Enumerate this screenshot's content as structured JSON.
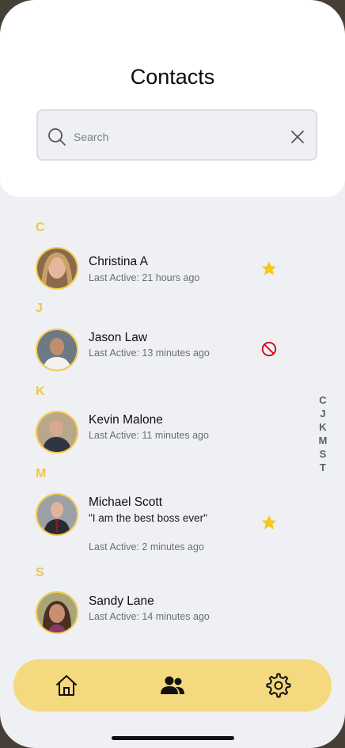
{
  "header": {
    "title": "Contacts"
  },
  "search": {
    "placeholder": "Search"
  },
  "sections": [
    {
      "letter": "C",
      "contacts": [
        {
          "name": "Christina A",
          "status": "Last Active: 21 hours ago",
          "icon": "star-icon"
        }
      ]
    },
    {
      "letter": "J",
      "contacts": [
        {
          "name": "Jason Law",
          "status": "Last Active: 13 minutes ago",
          "icon": "blocked-icon"
        }
      ]
    },
    {
      "letter": "K",
      "contacts": [
        {
          "name": "Kevin Malone",
          "status": "Last Active: 11 minutes ago"
        }
      ]
    },
    {
      "letter": "M",
      "contacts": [
        {
          "name": "Michael Scott",
          "quote": "\"I am the best boss ever\"",
          "status": "Last Active: 2 minutes ago",
          "icon": "star-icon"
        }
      ]
    },
    {
      "letter": "S",
      "contacts": [
        {
          "name": "Sandy Lane",
          "status": "Last Active: 14 minutes ago"
        }
      ]
    }
  ],
  "index_letters": [
    "C",
    "J",
    "K",
    "M",
    "S",
    "T"
  ],
  "nav": {
    "items": [
      "home-icon",
      "contacts-icon",
      "settings-icon"
    ]
  },
  "colors": {
    "accent": "#f5d97e",
    "letter": "#f0c64a",
    "star": "#f7c81c",
    "blocked": "#d0021b"
  }
}
